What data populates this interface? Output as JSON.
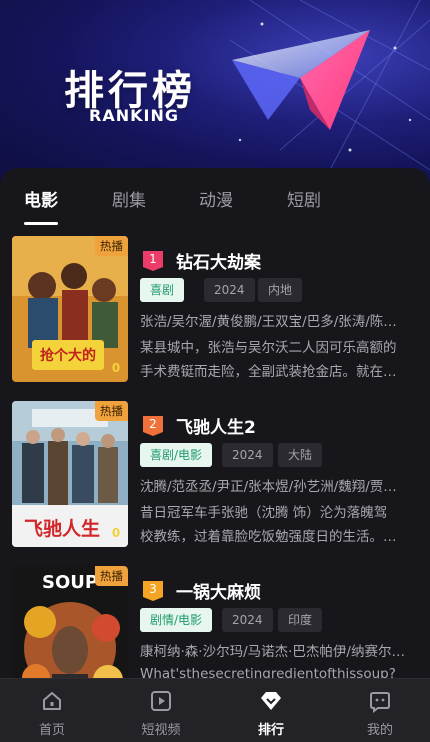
{
  "banner": {
    "title": "排行榜",
    "subtitle": "RANKING"
  },
  "tabs": [
    {
      "label": "电影",
      "active": true
    },
    {
      "label": "剧集",
      "active": false
    },
    {
      "label": "动漫",
      "active": false
    },
    {
      "label": "短剧",
      "active": false
    }
  ],
  "items": [
    {
      "rank": "1",
      "rank_color": "#ec3d6a",
      "title": "钻石大劫案",
      "hot_label": "热播",
      "poster_text": "抢个大的案子",
      "score": "0",
      "genre": "喜剧",
      "year": "2024",
      "region": "内地",
      "cast": "张浩/吴尔渥/黄俊鹏/王双宝/巴多/张涛/陈…",
      "synopsis": "某县城中，张浩与吴尔沃二人因可乐高额的手术费铤而走险，全副武装抢金店。就在…"
    },
    {
      "rank": "2",
      "rank_color": "#f2713a",
      "title": "飞驰人生2",
      "hot_label": "热播",
      "poster_text": "飞驰人生2",
      "score": "0",
      "genre": "喜剧/电影",
      "year": "2024",
      "region": "大陆",
      "cast": "沈腾/范丞丞/尹正/张本煜/孙艺洲/魏翔/贾…",
      "synopsis": "昔日冠军车手张驰（沈腾 饰）沦为落魄驾校教练，过着靠脸吃饭勉强度日的生活。…"
    },
    {
      "rank": "3",
      "rank_color": "#f2a422",
      "title": "一锅大麻烦",
      "hot_label": "热播",
      "poster_text": "SOUP",
      "score": "",
      "genre": "剧情/电影",
      "year": "2024",
      "region": "印度",
      "cast": "康柯纳·森·沙尔玛/马诺杰·巴杰帕伊/纳赛尔…",
      "synopsis": "What'sthesecretingredientofthissoup?"
    }
  ],
  "nav": [
    {
      "label": "首页",
      "icon": "home-icon",
      "active": false
    },
    {
      "label": "短视频",
      "icon": "play-icon",
      "active": false
    },
    {
      "label": "排行",
      "icon": "ranking-icon",
      "active": true
    },
    {
      "label": "我的",
      "icon": "profile-icon",
      "active": false
    }
  ]
}
